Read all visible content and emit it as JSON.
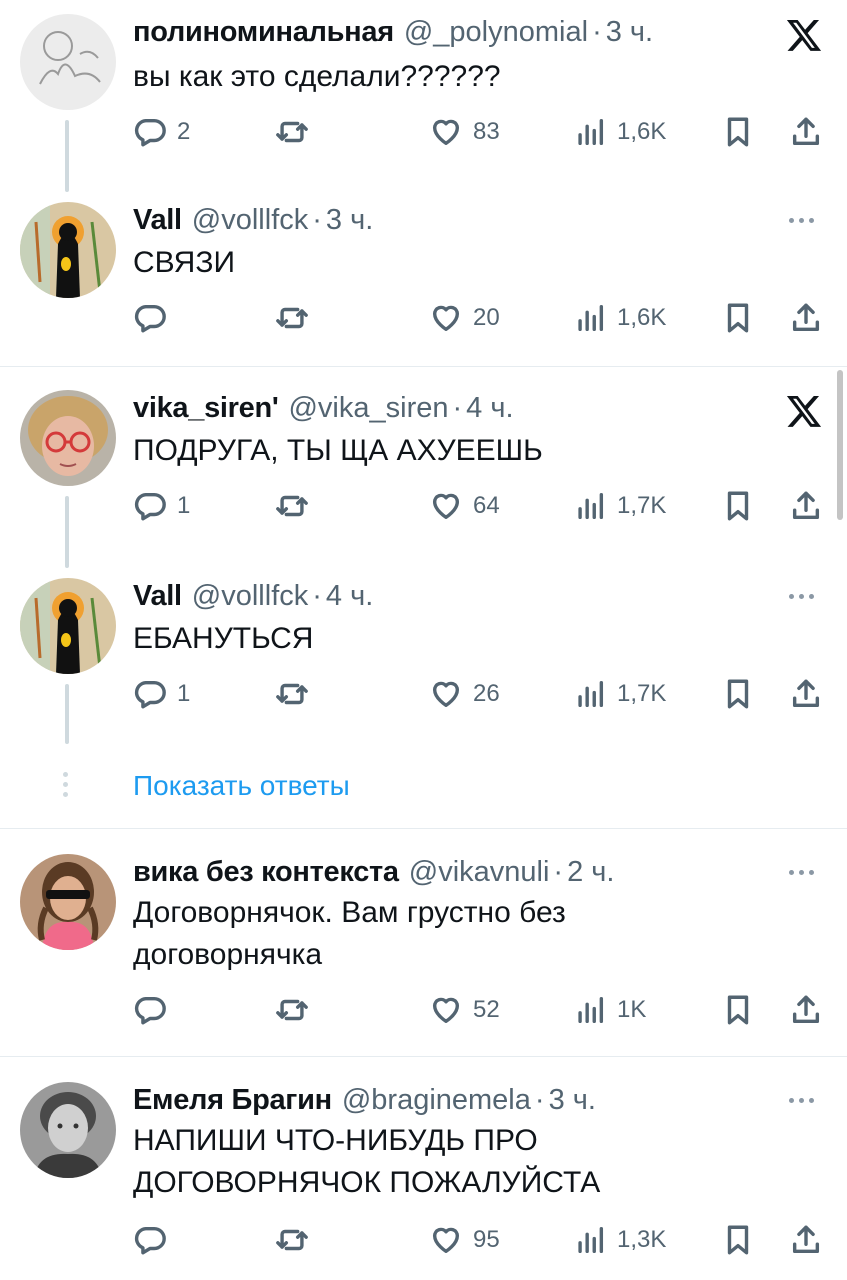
{
  "tweets": [
    {
      "name": "полиноминальная",
      "handle": "@_polynomial",
      "time": "3 ч.",
      "text": "вы как это сделали??????",
      "replies": "2",
      "retweets": "",
      "likes": "83",
      "views": "1,6K",
      "corner": "x-logo"
    },
    {
      "name": "Vall",
      "handle": "@volllfck",
      "time": "3 ч.",
      "text": "СВЯЗИ",
      "replies": "",
      "retweets": "",
      "likes": "20",
      "views": "1,6K",
      "corner": "more"
    },
    {
      "name": "vika_siren'",
      "handle": "@vika_siren",
      "time": "4 ч.",
      "text": "ПОДРУГА, ТЫ ЩА АХУЕЕШЬ",
      "replies": "1",
      "retweets": "",
      "likes": "64",
      "views": "1,7K",
      "corner": "x-logo"
    },
    {
      "name": "Vall",
      "handle": "@volllfck",
      "time": "4 ч.",
      "text": "ЕБАНУТЬСЯ",
      "replies": "1",
      "retweets": "",
      "likes": "26",
      "views": "1,7K",
      "corner": "more"
    },
    {
      "name": "вика без контекста",
      "handle": "@vikavnuli",
      "time": "2 ч.",
      "text_lines": [
        "Договорнячок. Вам грустно без",
        "договорнячка"
      ],
      "replies": "",
      "retweets": "",
      "likes": "52",
      "views": "1K",
      "corner": "more"
    },
    {
      "name": "Емеля Брагин",
      "handle": "@braginemela",
      "time": "3 ч.",
      "text_lines": [
        "НАПИШИ ЧТО-НИБУДЬ ПРО",
        "ДОГОВОРНЯЧОК ПОЖАЛУЙСТА"
      ],
      "replies": "",
      "retweets": "",
      "likes": "95",
      "views": "1,3K",
      "corner": "more"
    }
  ],
  "show_replies_label": "Показать ответы",
  "dot_separator": "·",
  "colors": {
    "text": "#0f1419",
    "secondary": "#536471",
    "link": "#1d9bf0",
    "thread_line": "#cfd9de",
    "divider": "#e6ecf0"
  }
}
